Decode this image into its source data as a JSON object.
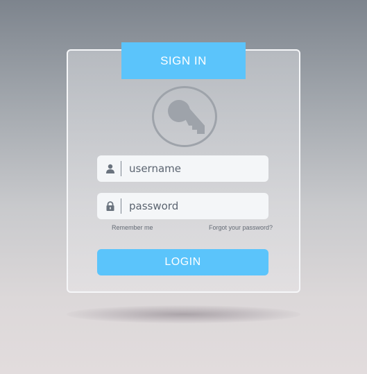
{
  "header": {
    "title": "SIGN IN"
  },
  "form": {
    "username": {
      "placeholder": "username",
      "value": "",
      "icon": "user-icon"
    },
    "password": {
      "placeholder": "password",
      "value": "",
      "icon": "lock-icon"
    },
    "remember_label": "Remember me",
    "forgot_label": "Forgot your password?",
    "login_label": "LOGIN"
  },
  "logo": {
    "icon": "key-icon"
  },
  "colors": {
    "accent": "#5bc4fb",
    "icon_gray": "#9ea3aa",
    "field_bg": "#f4f6f8",
    "text_gray": "#5b6470"
  }
}
